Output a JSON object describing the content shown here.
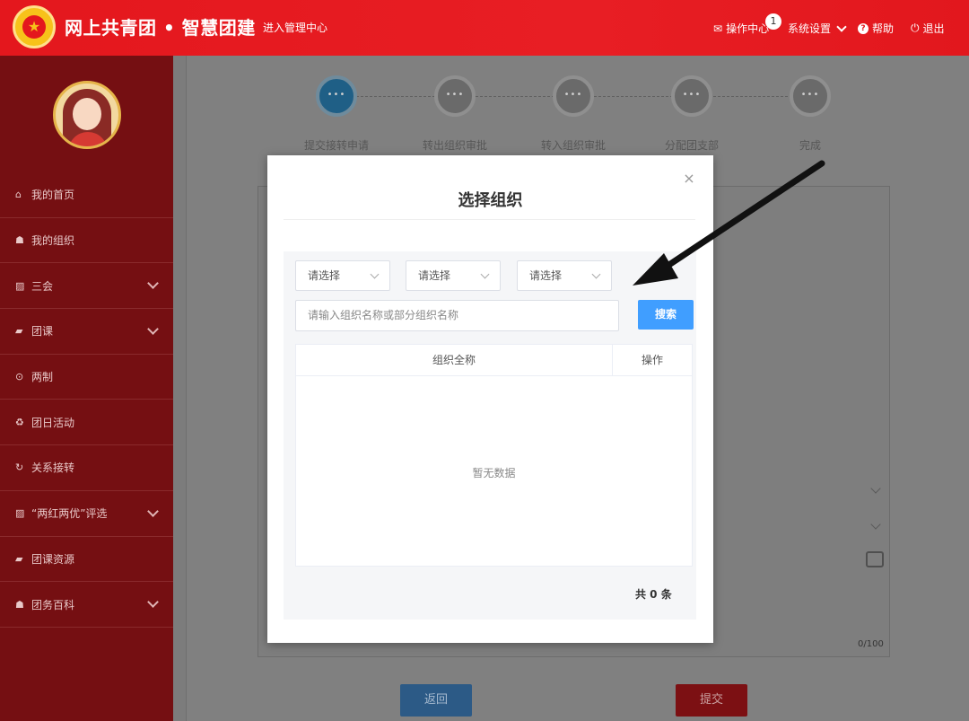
{
  "header": {
    "brand": "网上共青团 • 智慧团建",
    "admin_link": "进入管理中心",
    "ops_center": "操作中心",
    "ops_badge": "1",
    "settings": "系统设置",
    "help": "帮助",
    "exit": "退出"
  },
  "sidebar": {
    "items": [
      {
        "label": "我的首页",
        "icon": "home-icon"
      },
      {
        "label": "我的组织",
        "icon": "users-icon"
      },
      {
        "label": "三会",
        "icon": "edit-icon"
      },
      {
        "label": "团课",
        "icon": "folder-icon"
      },
      {
        "label": "两制",
        "icon": "target-icon"
      },
      {
        "label": "团日活动",
        "icon": "recycle-icon"
      },
      {
        "label": "关系接转",
        "icon": "refresh-icon"
      },
      {
        "label": "“两红两优”评选",
        "icon": "edit-icon"
      },
      {
        "label": "团课资源",
        "icon": "folder-icon"
      },
      {
        "label": "团务百科",
        "icon": "users-icon"
      }
    ]
  },
  "steps": [
    "提交接转申请",
    "转出组织审批",
    "转入组织审批",
    "分配团支部",
    "完成"
  ],
  "form": {
    "counter": "0/100",
    "back_label": "返回",
    "submit_label": "提交"
  },
  "modal": {
    "close": "×",
    "title": "选择组织",
    "selects": [
      "请选择",
      "请选择",
      "请选择"
    ],
    "search_placeholder": "请输入组织名称或部分组织名称",
    "search_button": "搜索",
    "table_headers": {
      "name": "组织全称",
      "operation": "操作"
    },
    "empty_text": "暂无数据",
    "total_text": "共 0 条"
  },
  "colors": {
    "header_red": "#e4171d",
    "sidebar_dark_red": "#750f12",
    "primary_blue": "#409eff"
  }
}
